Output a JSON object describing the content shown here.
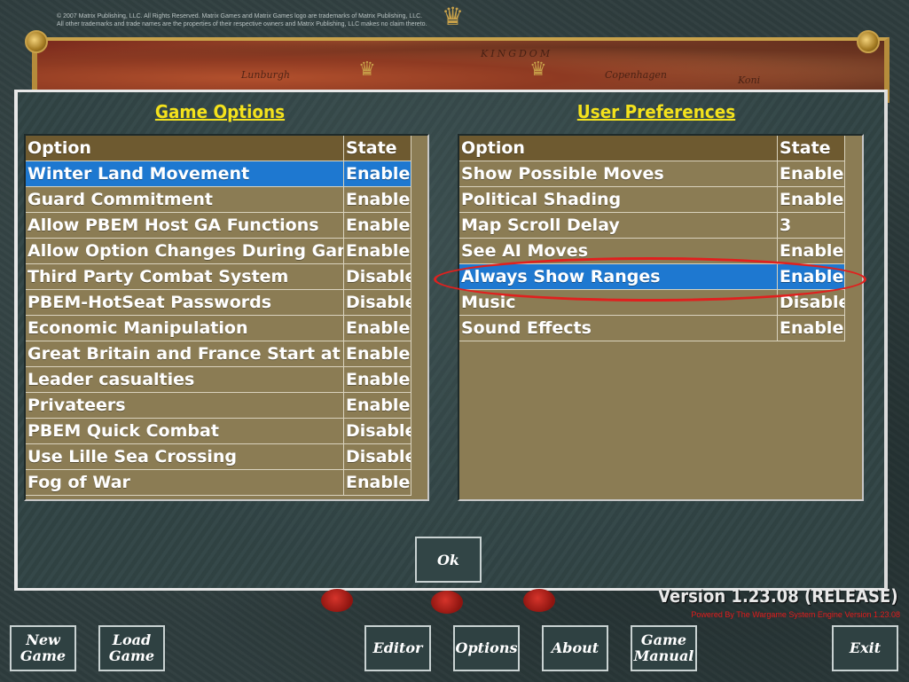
{
  "copyright": "© 2007 Matrix Publishing, LLC. All Rights Reserved. Matrix Games and Matrix Games logo are trademarks of Matrix Publishing, LLC.\nAll other trademarks and trade names are the properties of their respective owners and Matrix Publishing, LLC makes no claim thereto.",
  "map_labels": [
    "KINGDOM",
    "Copenhagen",
    "Lunburgh",
    "Koni"
  ],
  "game_options": {
    "title": "Game Options",
    "col_option": "Option",
    "col_state": "State",
    "rows": [
      {
        "option": "Winter Land Movement",
        "state": "Enabled",
        "selected": true
      },
      {
        "option": "Guard Commitment",
        "state": "Enabled"
      },
      {
        "option": "Allow PBEM Host GA Functions",
        "state": "Enabled"
      },
      {
        "option": "Allow Option Changes During Game",
        "state": "Enabled"
      },
      {
        "option": "Third Party Combat System",
        "state": "Disabled"
      },
      {
        "option": "PBEM-HotSeat Passwords",
        "state": "Disabled"
      },
      {
        "option": "Economic Manipulation",
        "state": "Enabled"
      },
      {
        "option": "Great Britain and France Start at War",
        "state": "Enabled"
      },
      {
        "option": "Leader casualties",
        "state": "Enabled"
      },
      {
        "option": "Privateers",
        "state": "Enabled"
      },
      {
        "option": "PBEM Quick Combat",
        "state": "Disabled"
      },
      {
        "option": "Use Lille Sea Crossing",
        "state": "Disabled"
      },
      {
        "option": "Fog of War",
        "state": "Enabled"
      }
    ]
  },
  "user_preferences": {
    "title": "User Preferences",
    "col_option": "Option",
    "col_state": "State",
    "rows": [
      {
        "option": "Show Possible Moves",
        "state": "Enabled"
      },
      {
        "option": "Political Shading",
        "state": "Enabled"
      },
      {
        "option": "Map Scroll Delay",
        "state": "3"
      },
      {
        "option": "See AI Moves",
        "state": "Enabled"
      },
      {
        "option": "Always Show Ranges",
        "state": "Enabled",
        "selected": true
      },
      {
        "option": "Music",
        "state": "Disabled"
      },
      {
        "option": "Sound Effects",
        "state": "Enabled"
      }
    ]
  },
  "ok_label": "Ok",
  "version": "Version 1.23.08 (RELEASE)",
  "engine": "Powered By The Wargame System Engine Version 1.23.08",
  "menu": {
    "new_game": "New\nGame",
    "load_game": "Load\nGame",
    "editor": "Editor",
    "options": "Options",
    "about": "About",
    "game_manual": "Game\nManual",
    "exit": "Exit"
  },
  "colors": {
    "title_yellow": "#f4e21c",
    "row_bg": "#8b7c54",
    "header_bg": "#6e5a30",
    "selected_bg": "#1e78d0",
    "highlight_ellipse": "#e0201e",
    "engine_text": "#e31b1b"
  },
  "icons": [
    "eagle-icon",
    "gold-bolt-icon",
    "wax-seal-icon"
  ]
}
